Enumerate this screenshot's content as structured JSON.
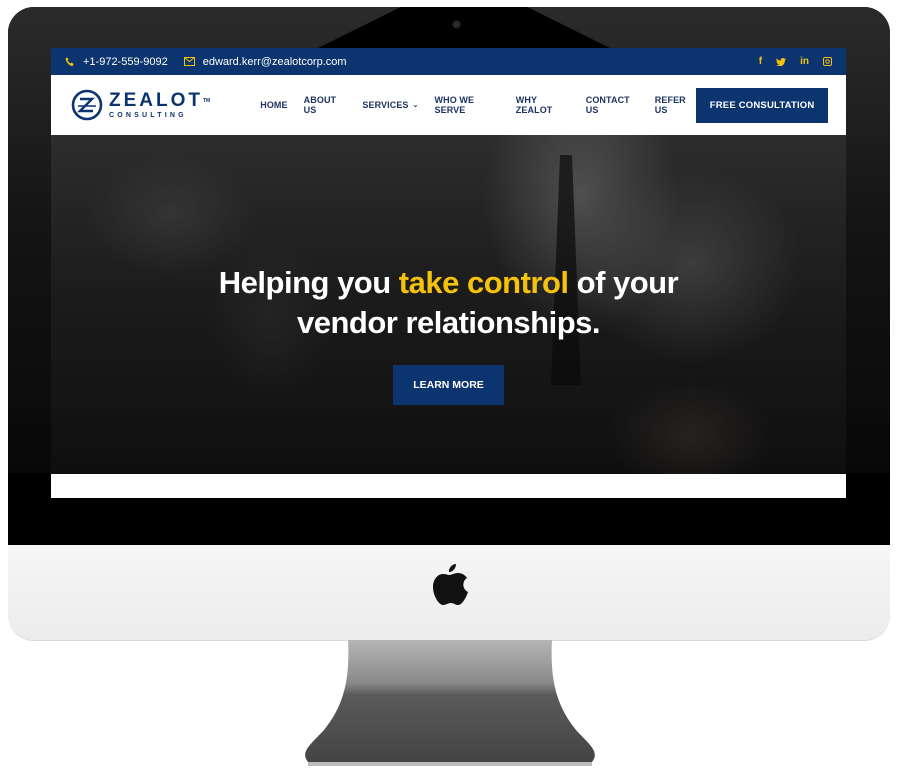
{
  "device": {
    "type": "iMac mockup",
    "logo": "apple-logo"
  },
  "topbar": {
    "phone_icon": "phone-icon",
    "phone": "+1-972-559-9092",
    "email_icon": "envelope-icon",
    "email": "edward.kerr@zealotcorp.com",
    "social": [
      {
        "name": "facebook-icon",
        "glyph": "f"
      },
      {
        "name": "twitter-icon",
        "glyph": "t"
      },
      {
        "name": "linkedin-icon",
        "glyph": "in"
      },
      {
        "name": "instagram-icon",
        "glyph": "ig"
      }
    ]
  },
  "logo": {
    "title": "ZEALOT",
    "trademark": "TM",
    "subtitle": "CONSULTING"
  },
  "nav": {
    "items": [
      {
        "label": "HOME"
      },
      {
        "label": "ABOUT US"
      },
      {
        "label": "SERVICES",
        "dropdown": true
      },
      {
        "label": "WHO WE SERVE"
      },
      {
        "label": "WHY ZEALOT"
      },
      {
        "label": "CONTACT US"
      },
      {
        "label": "REFER US"
      }
    ],
    "cta_label": "FREE CONSULTATION"
  },
  "hero": {
    "headline_part1": "Helping you ",
    "headline_accent": "take control",
    "headline_part2": " of your",
    "headline_line2": "vendor relationships.",
    "button_label": "LEARN MORE"
  },
  "colors": {
    "brand_navy": "#0c346e",
    "accent_yellow": "#f4c20d"
  }
}
